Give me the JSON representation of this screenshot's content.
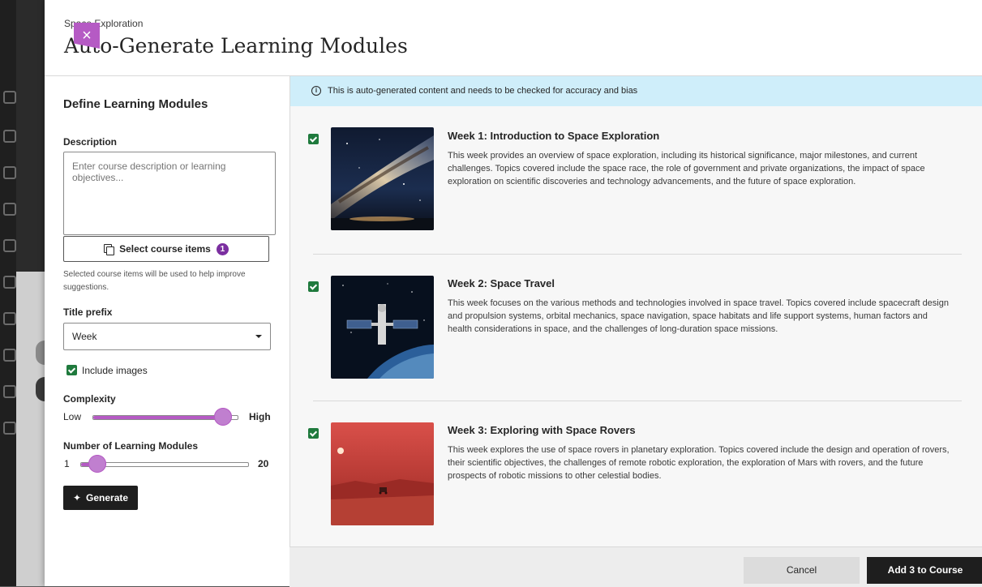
{
  "header": {
    "course_name": "Space Exploration",
    "title": "Auto-Generate Learning Modules",
    "close_icon": "close-icon"
  },
  "form": {
    "section_title": "Define Learning Modules",
    "description_label": "Description",
    "description_value": "",
    "description_placeholder": "Enter course description or learning objectives...",
    "select_items_label": "Select course items",
    "select_items_count": "1",
    "helper_text": "Selected course items will be used to help improve suggestions.",
    "title_prefix_label": "Title prefix",
    "title_prefix_value": "Week",
    "include_images_label": "Include images",
    "include_images_checked": true,
    "complexity_label": "Complexity",
    "complexity_min": "Low",
    "complexity_max": "High",
    "complexity_level": 0.9,
    "modules_label": "Number of Learning Modules",
    "modules_min": "1",
    "modules_max": "20",
    "modules_value": 1,
    "generate_label": "Generate"
  },
  "results": {
    "notice": "This is auto-generated content and needs to be checked for accuracy and bias",
    "modules": [
      {
        "checked": true,
        "title": "Week 1: Introduction to Space Exploration",
        "description": "This week provides an overview of space exploration, including its historical significance, major milestones, and current challenges. Topics covered include the space race, the role of government and private organizations, the impact of space exploration on scientific discoveries and technology advancements, and the future of space exploration.",
        "image": "galaxy-image"
      },
      {
        "checked": true,
        "title": "Week 2: Space Travel",
        "description": "This week focuses on the various methods and technologies involved in space travel. Topics covered include spacecraft design and propulsion systems, orbital mechanics, space navigation, space habitats and life support systems, human factors and health considerations in space, and the challenges of long-duration space missions.",
        "image": "space-station-image"
      },
      {
        "checked": true,
        "title": "Week 3: Exploring with Space Rovers",
        "description": "This week explores the use of space rovers in planetary exploration. Topics covered include the design and operation of rovers, their scientific objectives, the challenges of remote robotic exploration, the exploration of Mars with rovers, and the future prospects of robotic missions to other celestial bodies.",
        "image": "mars-rover-image"
      }
    ]
  },
  "footer": {
    "cancel_label": "Cancel",
    "add_label": "Add 3 to Course"
  },
  "colors": {
    "accent": "#b55ac4",
    "badge": "#7b2fa0",
    "check": "#1f7a3d",
    "notice_bg": "#cfeefa",
    "primary_button": "#1e1e1e"
  }
}
